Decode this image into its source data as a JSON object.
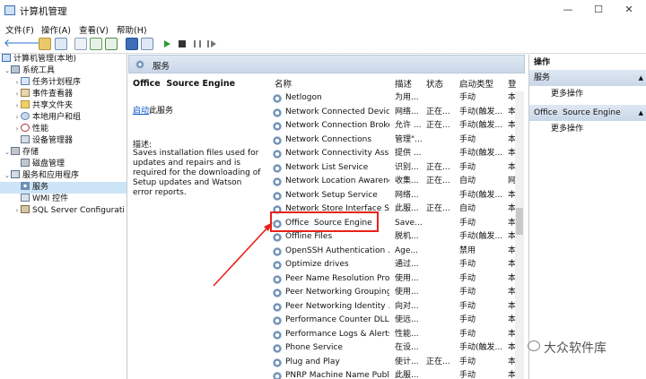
{
  "window": {
    "title": "计算机管理",
    "minimize": "—",
    "maximize": "☐",
    "close": "✕"
  },
  "menu": [
    "文件(F)",
    "操作(A)",
    "查看(V)",
    "帮助(H)"
  ],
  "tree": {
    "root": "计算机管理(本地)",
    "system_tools": "系统工具",
    "task_scheduler": "任务计划程序",
    "event_viewer": "事件查看器",
    "shared_folders": "共享文件夹",
    "local_users": "本地用户和组",
    "performance": "性能",
    "device_manager": "设备管理器",
    "storage": "存储",
    "disk_management": "磁盘管理",
    "services_apps": "服务和应用程序",
    "services": "服务",
    "wmi": "WMI 控件",
    "sql": "SQL Server Configurati"
  },
  "services_header": "服务",
  "detail": {
    "title": "Office  Source Engine",
    "start_link": "启动",
    "start_suffix": "此服务",
    "desc_label": "描述:",
    "description": "Saves installation files used for updates and repairs and is required for the downloading of Setup updates and Watson error reports."
  },
  "columns": {
    "name": "名称",
    "desc": "描述",
    "status": "状态",
    "startup": "启动类型",
    "logon": "登"
  },
  "rows": [
    {
      "name": "Netlogon",
      "desc": "为用...",
      "status": "",
      "startup": "手动",
      "logon": "本"
    },
    {
      "name": "Network Connected Devic...",
      "desc": "网络...",
      "status": "正在...",
      "startup": "手动(触发...",
      "logon": "本"
    },
    {
      "name": "Network Connection Broker",
      "desc": "允许 ...",
      "status": "正在...",
      "startup": "手动(触发...",
      "logon": "本"
    },
    {
      "name": "Network Connections",
      "desc": "管理\"...",
      "status": "",
      "startup": "手动",
      "logon": "本"
    },
    {
      "name": "Network Connectivity Assis...",
      "desc": "提供 ...",
      "status": "",
      "startup": "手动(触发...",
      "logon": "本"
    },
    {
      "name": "Network List Service",
      "desc": "识别...",
      "status": "正在...",
      "startup": "手动",
      "logon": "本"
    },
    {
      "name": "Network Location Awarene...",
      "desc": "收集...",
      "status": "正在...",
      "startup": "自动",
      "logon": "网"
    },
    {
      "name": "Network Setup Service",
      "desc": "网络...",
      "status": "",
      "startup": "手动(触发...",
      "logon": "本"
    },
    {
      "name": "Network Store Interface Se...",
      "desc": "此服...",
      "status": "正在...",
      "startup": "自动",
      "logon": "本"
    },
    {
      "name": "Office  Source Engine",
      "desc": "Save...",
      "status": "",
      "startup": "手动",
      "logon": "本"
    },
    {
      "name": "Offline Files",
      "desc": "脱机...",
      "status": "",
      "startup": "手动(触发...",
      "logon": "本"
    },
    {
      "name": "OpenSSH Authentication ...",
      "desc": "Age...",
      "status": "",
      "startup": "禁用",
      "logon": "本"
    },
    {
      "name": "Optimize drives",
      "desc": "通过...",
      "status": "",
      "startup": "手动",
      "logon": "本"
    },
    {
      "name": "Peer Name Resolution Pro...",
      "desc": "使用...",
      "status": "",
      "startup": "手动",
      "logon": "本"
    },
    {
      "name": "Peer Networking Grouping",
      "desc": "使用...",
      "status": "",
      "startup": "手动",
      "logon": "本"
    },
    {
      "name": "Peer Networking Identity ...",
      "desc": "向对...",
      "status": "",
      "startup": "手动",
      "logon": "本"
    },
    {
      "name": "Performance Counter DLL ...",
      "desc": "使远...",
      "status": "",
      "startup": "手动",
      "logon": "本"
    },
    {
      "name": "Performance Logs & Alerts",
      "desc": "性能...",
      "status": "",
      "startup": "手动",
      "logon": "本"
    },
    {
      "name": "Phone Service",
      "desc": "在设...",
      "status": "",
      "startup": "手动(触发...",
      "logon": "本"
    },
    {
      "name": "Plug and Play",
      "desc": "使计...",
      "status": "正在...",
      "startup": "手动",
      "logon": "本"
    },
    {
      "name": "PNRP Machine Name Publ...",
      "desc": "此服...",
      "status": "",
      "startup": "手动",
      "logon": "本"
    }
  ],
  "actions": {
    "header": "操作",
    "section1": "服务",
    "more1": "更多操作",
    "section2": "Office  Source Engine",
    "more2": "更多操作"
  },
  "watermark": "大众软件库",
  "colors": {
    "highlight_box": "#e8211c",
    "arrow": "#e8211c",
    "link": "#0b57c6",
    "selected": "#cce4f7"
  }
}
